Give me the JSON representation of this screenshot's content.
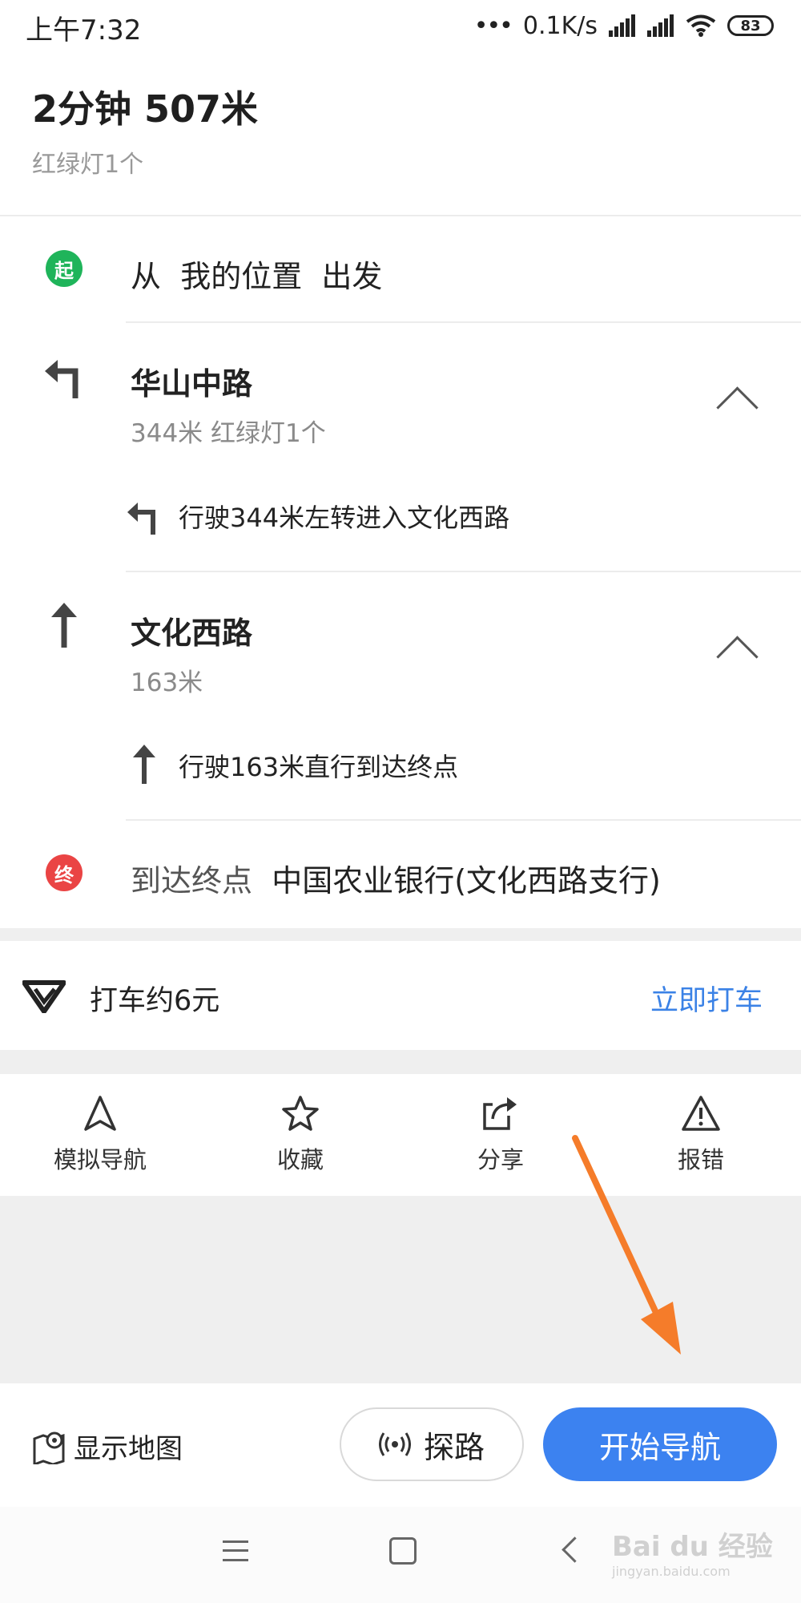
{
  "status_bar": {
    "time": "上午7:32",
    "speed": "0.1K/s",
    "battery": "83"
  },
  "summary": {
    "title": "2分钟  507米",
    "traffic_lights": "红绿灯1个"
  },
  "route": {
    "start": {
      "badge": "起",
      "prefix": "从",
      "location": "我的位置",
      "suffix": "出发"
    },
    "steps": [
      {
        "road": "华山中路",
        "info": "344米 红绿灯1个",
        "detail": "行驶344米左转进入文化西路",
        "icon": "turn-left-icon"
      },
      {
        "road": "文化西路",
        "info": "163米",
        "detail": "行驶163米直行到达终点",
        "icon": "straight-icon"
      }
    ],
    "end": {
      "badge": "终",
      "prefix": "到达终点",
      "destination": "中国农业银行(文化西路支行)"
    }
  },
  "taxi": {
    "label": "打车约6元",
    "action": "立即打车"
  },
  "actions": [
    {
      "label": "模拟导航",
      "icon": "navigation-arrow-icon"
    },
    {
      "label": "收藏",
      "icon": "star-icon"
    },
    {
      "label": "分享",
      "icon": "share-icon"
    },
    {
      "label": "报错",
      "icon": "warning-icon"
    }
  ],
  "bottom_bar": {
    "show_map": "显示地图",
    "explore": "探路",
    "start_nav": "开始导航"
  },
  "watermark": {
    "text": "Bai du 经验",
    "sub": "jingyan.baidu.com"
  },
  "colors": {
    "primary": "#3c82f0",
    "start_badge": "#1fb45a",
    "end_badge": "#ea4444",
    "annotation_arrow": "#f57c2a"
  }
}
